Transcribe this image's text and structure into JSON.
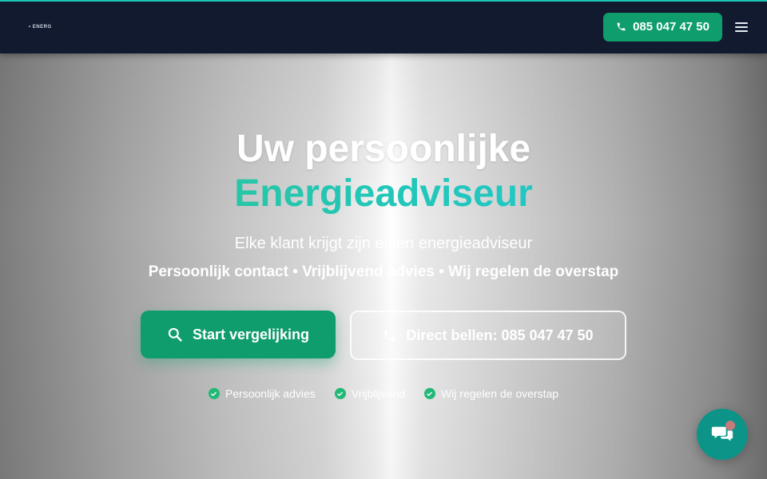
{
  "header": {
    "logo_text": "• ENERG",
    "phone_label": "085 047 47 50"
  },
  "hero": {
    "title_line1": "Uw persoonlijke",
    "title_line2": "Energieadviseur",
    "subtitle": "Elke klant krijgt zijn eigen energieadviseur",
    "usp_line": "Persoonlijk contact • Vrijblijvend advies • Wij regelen de overstap",
    "primary_cta": "Start vergelijking",
    "secondary_cta": "Direct bellen: 085 047 47 50",
    "trust_items": [
      "Persoonlijk advies",
      "Vrijblijvend",
      "Wij regelen de overstap"
    ]
  },
  "colors": {
    "header_bg": "#111a2e",
    "accent_green": "#0f9d6e",
    "teal": "#22c7b8",
    "chat_bg": "#0d9488"
  },
  "icons": {
    "phone": "phone-icon",
    "menu": "menu-icon",
    "search": "search-icon",
    "check": "check-icon",
    "chat": "chat-icon"
  }
}
